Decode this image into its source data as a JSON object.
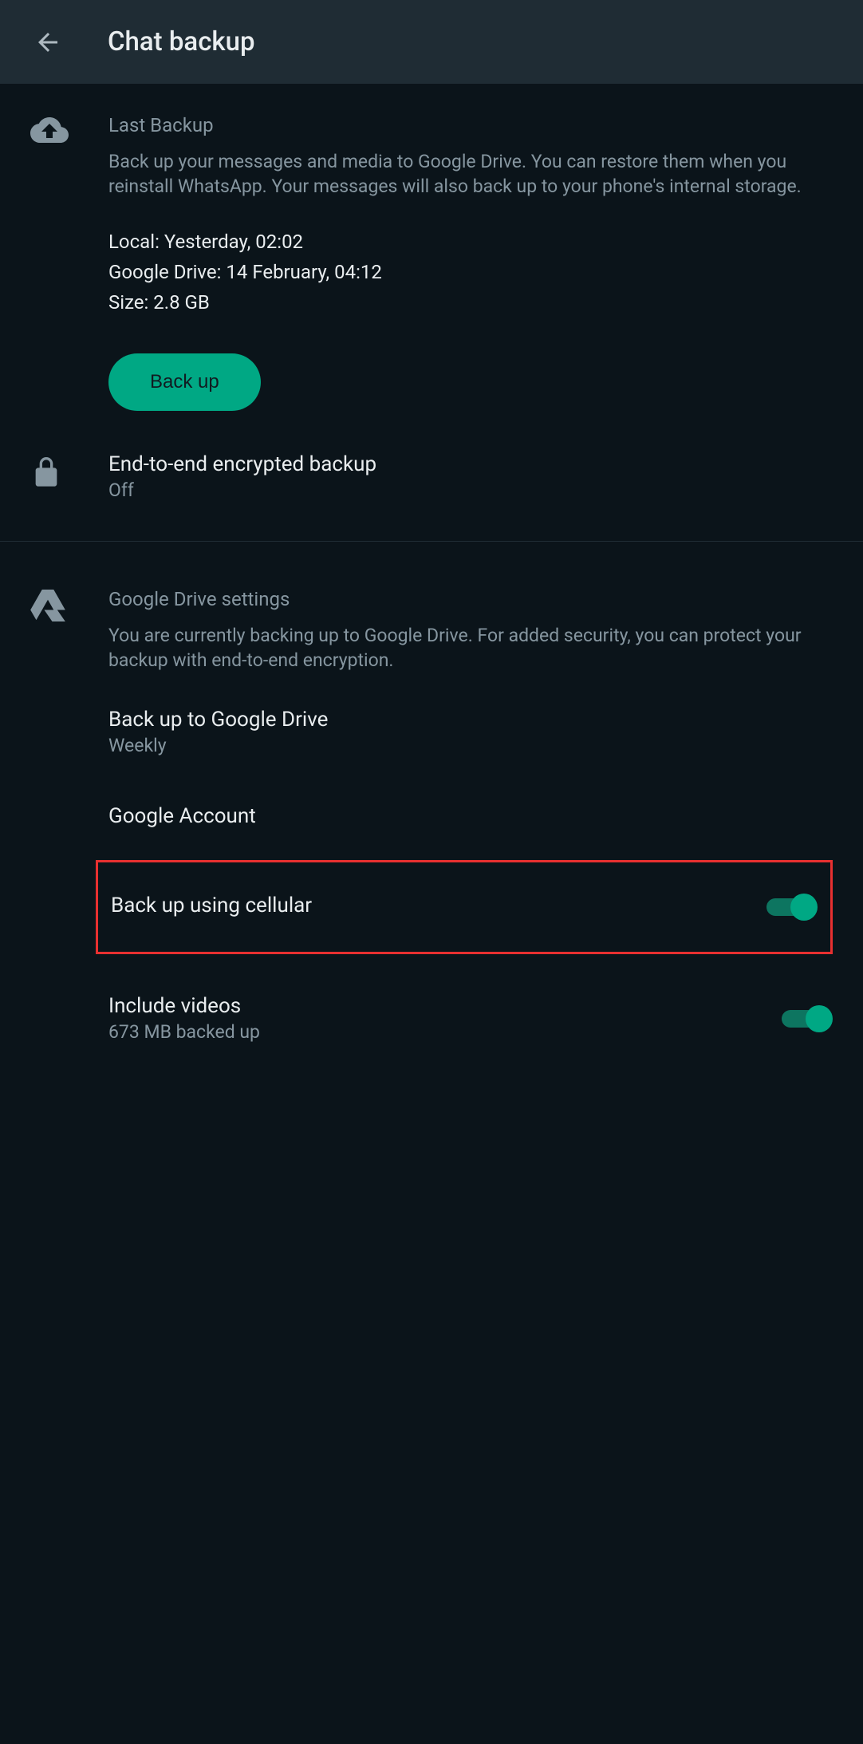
{
  "header": {
    "title": "Chat backup"
  },
  "lastBackup": {
    "title": "Last Backup",
    "description": "Back up your messages and media to Google Drive. You can restore them when you reinstall WhatsApp. Your messages will also back up to your phone's internal storage.",
    "local": "Local: Yesterday, 02:02",
    "googleDrive": "Google Drive: 14 February, 04:12",
    "size": "Size: 2.8 GB",
    "buttonLabel": "Back up"
  },
  "encryptedBackup": {
    "title": "End-to-end encrypted backup",
    "status": "Off"
  },
  "googleDriveSettings": {
    "title": "Google Drive settings",
    "description": "You are currently backing up to Google Drive. For added security, you can protect your backup with end-to-end encryption.",
    "backupFrequency": {
      "title": "Back up to Google Drive",
      "value": "Weekly"
    },
    "googleAccount": {
      "title": "Google Account"
    },
    "cellular": {
      "title": "Back up using cellular",
      "enabled": true
    },
    "includeVideos": {
      "title": "Include videos",
      "subtitle": "673 MB backed up",
      "enabled": true
    }
  }
}
